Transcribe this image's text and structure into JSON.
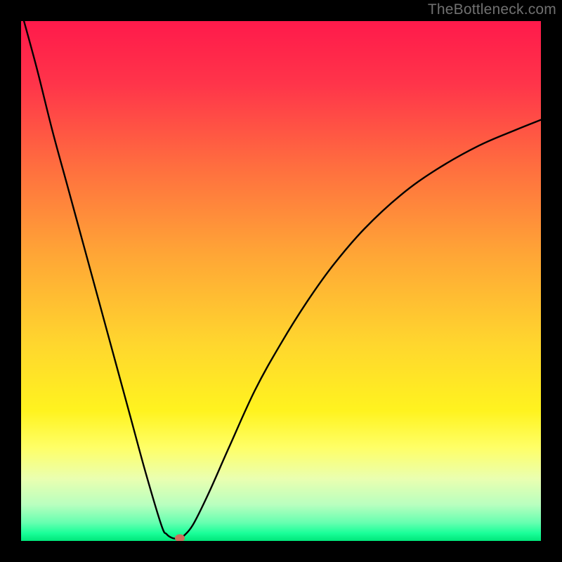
{
  "watermark": "TheBottleneck.com",
  "colors": {
    "background": "#000000",
    "curve": "#000000",
    "dot": "#cc6f5c",
    "gradient_stops": [
      {
        "offset": 0.0,
        "color": "#ff1a4b"
      },
      {
        "offset": 0.12,
        "color": "#ff344a"
      },
      {
        "offset": 0.28,
        "color": "#ff6e3f"
      },
      {
        "offset": 0.45,
        "color": "#ffa636"
      },
      {
        "offset": 0.62,
        "color": "#ffd62e"
      },
      {
        "offset": 0.75,
        "color": "#fff31f"
      },
      {
        "offset": 0.82,
        "color": "#ffff66"
      },
      {
        "offset": 0.88,
        "color": "#eaffb0"
      },
      {
        "offset": 0.93,
        "color": "#b9ffbf"
      },
      {
        "offset": 0.965,
        "color": "#66ffb0"
      },
      {
        "offset": 0.985,
        "color": "#1aff99"
      },
      {
        "offset": 1.0,
        "color": "#00e67a"
      }
    ]
  },
  "chart_data": {
    "type": "line",
    "title": "",
    "xlabel": "",
    "ylabel": "",
    "xlim": [
      0,
      100
    ],
    "ylim": [
      0,
      100
    ],
    "series": [
      {
        "name": "bottleneck-curve",
        "x": [
          0,
          3,
          6,
          9,
          12,
          15,
          18,
          21,
          24,
          27,
          28,
          29,
          30,
          30.5,
          31,
          33,
          36,
          40,
          45,
          50,
          55,
          60,
          66,
          73,
          80,
          88,
          95,
          100
        ],
        "y": [
          102,
          91,
          79,
          68,
          57,
          46,
          35,
          24,
          13,
          3,
          1.3,
          0.6,
          0.4,
          0.4,
          0.7,
          3,
          9,
          18,
          29,
          38,
          46,
          53,
          60,
          66.5,
          71.5,
          76,
          79,
          81
        ]
      }
    ],
    "marker": {
      "x": 30.5,
      "y": 0.5,
      "color": "#cc6f5c"
    },
    "note": "x is relative horizontal position (0–100), y is relative vertical position from bottom (0–100). Values estimated from the image."
  }
}
